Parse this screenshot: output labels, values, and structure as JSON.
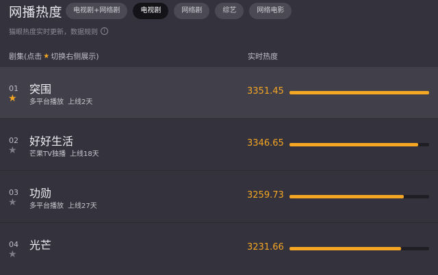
{
  "header": {
    "title": "网播热度",
    "tabs": [
      {
        "label": "电视剧+网络剧",
        "active": false
      },
      {
        "label": "电视剧",
        "active": true
      },
      {
        "label": "网络剧",
        "active": false
      },
      {
        "label": "综艺",
        "active": false
      },
      {
        "label": "网络电影",
        "active": false
      }
    ]
  },
  "notice": {
    "text": "猫眼热度实时更新，数据规则",
    "icon": "info-icon"
  },
  "columns": {
    "left_prefix": "剧集(点击",
    "left_suffix": "切换右侧展示)",
    "right": "实时热度"
  },
  "rows": [
    {
      "rank": "01",
      "name": "突围",
      "platform": "多平台播放",
      "online": "上线2天",
      "score": "3351.45",
      "fraction": 1.0,
      "selected": true
    },
    {
      "rank": "02",
      "name": "好好生活",
      "platform": "芒果TV独播",
      "online": "上线18天",
      "score": "3346.65",
      "fraction": 0.92,
      "selected": false
    },
    {
      "rank": "03",
      "name": "功勋",
      "platform": "多平台播放",
      "online": "上线27天",
      "score": "3259.73",
      "fraction": 0.82,
      "selected": false
    },
    {
      "rank": "04",
      "name": "光芒",
      "platform": "",
      "online": "",
      "score": "3231.66",
      "fraction": 0.8,
      "selected": false
    }
  ],
  "colors": {
    "accent": "#f5a623",
    "background": "#34333d",
    "active_tab": "#141418"
  }
}
